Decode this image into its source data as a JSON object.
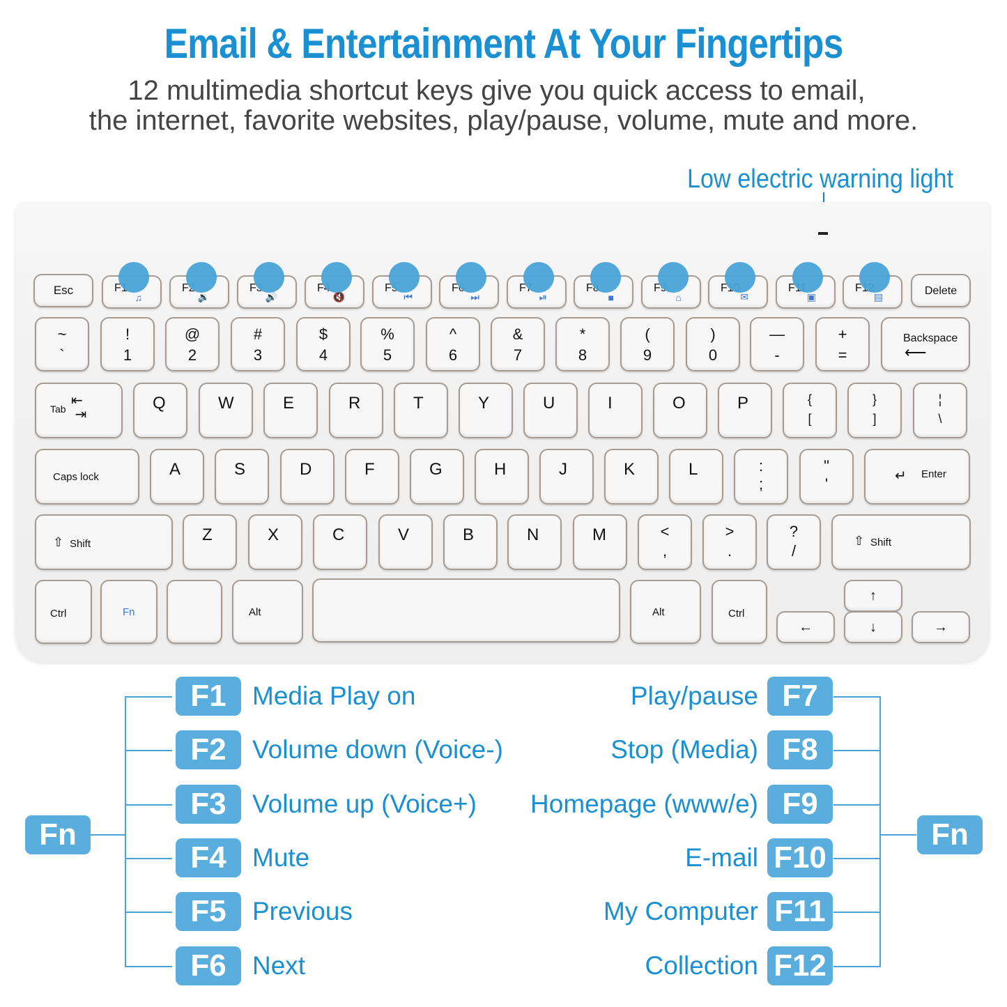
{
  "header": {
    "title": "Email & Entertainment At Your Fingertips",
    "subtitle_line1": "12 multimedia shortcut keys give you quick access to email,",
    "subtitle_line2": "the internet, favorite websites, play/pause, volume, mute and more."
  },
  "callout": {
    "low_battery_light": "Low electric warning light"
  },
  "colors": {
    "accent": "#1a8fd1",
    "badge": "#5aaedd",
    "key_border": "#a49c94",
    "fn_icon": "#3a78d8"
  },
  "keyboard": {
    "esc": "Esc",
    "delete": "Delete",
    "fkeys": [
      {
        "label": "F1",
        "icon": "music-note-icon",
        "glyph": "♫"
      },
      {
        "label": "F2",
        "icon": "volume-down-icon",
        "glyph": "🔉"
      },
      {
        "label": "F3",
        "icon": "volume-up-icon",
        "glyph": "🔊"
      },
      {
        "label": "F4",
        "icon": "mute-icon",
        "glyph": "🔇"
      },
      {
        "label": "F5",
        "icon": "previous-track-icon",
        "glyph": "⏮"
      },
      {
        "label": "F6",
        "icon": "next-track-icon",
        "glyph": "⏭"
      },
      {
        "label": "F7",
        "icon": "play-pause-icon",
        "glyph": "⏯"
      },
      {
        "label": "F8",
        "icon": "stop-icon",
        "glyph": "■"
      },
      {
        "label": "F9",
        "icon": "home-icon",
        "glyph": "⌂"
      },
      {
        "label": "F10",
        "icon": "mail-icon",
        "glyph": "✉"
      },
      {
        "label": "F11",
        "icon": "computer-icon",
        "glyph": "▣"
      },
      {
        "label": "F12",
        "icon": "favorites-folder-icon",
        "glyph": "▤"
      }
    ],
    "number_row": [
      {
        "top": "~",
        "bottom": "`"
      },
      {
        "top": "!",
        "bottom": "1"
      },
      {
        "top": "@",
        "bottom": "2"
      },
      {
        "top": "#",
        "bottom": "3"
      },
      {
        "top": "$",
        "bottom": "4"
      },
      {
        "top": "%",
        "bottom": "5"
      },
      {
        "top": "^",
        "bottom": "6"
      },
      {
        "top": "&",
        "bottom": "7"
      },
      {
        "top": "*",
        "bottom": "8"
      },
      {
        "top": "(",
        "bottom": "9"
      },
      {
        "top": ")",
        "bottom": "0"
      },
      {
        "top": "—",
        "bottom": "-"
      },
      {
        "top": "+",
        "bottom": "="
      }
    ],
    "backspace": "Backspace",
    "tab": "Tab",
    "qwerty_row": [
      "Q",
      "W",
      "E",
      "R",
      "T",
      "Y",
      "U",
      "I",
      "O",
      "P"
    ],
    "bracket_keys": [
      {
        "top": "{",
        "bottom": "["
      },
      {
        "top": "}",
        "bottom": "]"
      },
      {
        "top": "¦",
        "bottom": "\\"
      }
    ],
    "caps_lock": "Caps lock",
    "asdf_row": [
      "A",
      "S",
      "D",
      "F",
      "G",
      "H",
      "J",
      "K",
      "L"
    ],
    "semi_keys": [
      {
        "top": ":",
        "bottom": ";"
      },
      {
        "top": "\"",
        "bottom": "'"
      }
    ],
    "enter": "Enter",
    "shift": "Shift",
    "zxcv_row": [
      "Z",
      "X",
      "C",
      "V",
      "B",
      "N",
      "M"
    ],
    "punct_keys": [
      {
        "top": "<",
        "bottom": ","
      },
      {
        "top": ">",
        "bottom": "."
      },
      {
        "top": "?",
        "bottom": "/"
      }
    ],
    "ctrl": "Ctrl",
    "fn": "Fn",
    "alt": "Alt",
    "arrows": {
      "up": "↑",
      "down": "↓",
      "left": "←",
      "right": "→"
    }
  },
  "legend": {
    "fn_label": "Fn",
    "left": [
      {
        "key": "F1",
        "desc": "Media Play on"
      },
      {
        "key": "F2",
        "desc": "Volume down (Voice-)"
      },
      {
        "key": "F3",
        "desc": "Volume up (Voice+)"
      },
      {
        "key": "F4",
        "desc": "Mute"
      },
      {
        "key": "F5",
        "desc": "Previous"
      },
      {
        "key": "F6",
        "desc": "Next"
      }
    ],
    "right": [
      {
        "key": "F7",
        "desc": "Play/pause"
      },
      {
        "key": "F8",
        "desc": "Stop (Media)"
      },
      {
        "key": "F9",
        "desc": "Homepage (www/e)"
      },
      {
        "key": "F10",
        "desc": "E-mail"
      },
      {
        "key": "F11",
        "desc": "My Computer"
      },
      {
        "key": "F12",
        "desc": "Collection"
      }
    ]
  }
}
